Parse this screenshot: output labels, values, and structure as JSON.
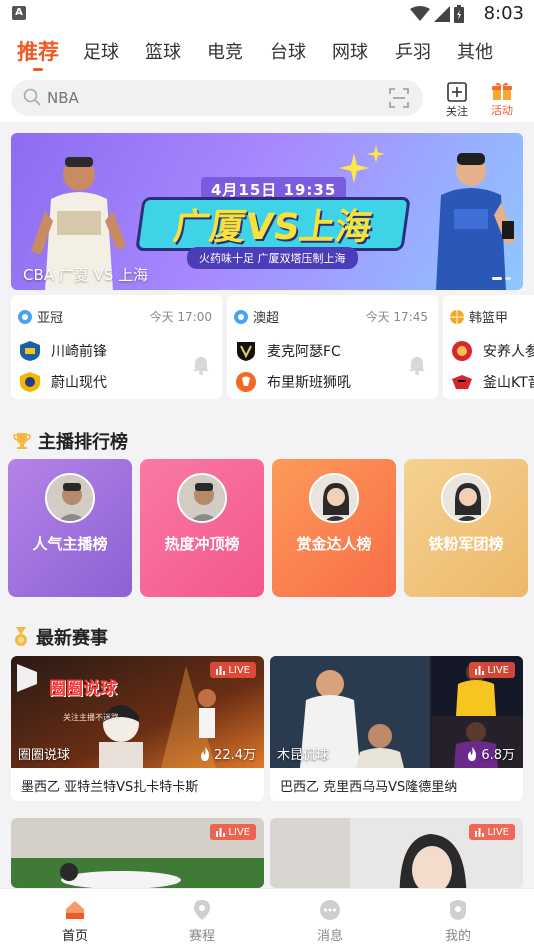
{
  "statusbar": {
    "time": "8:03",
    "app_badge": "A"
  },
  "tabs": [
    {
      "label": "推荐"
    },
    {
      "label": "足球"
    },
    {
      "label": "篮球"
    },
    {
      "label": "电竞"
    },
    {
      "label": "台球"
    },
    {
      "label": "网球"
    },
    {
      "label": "乒羽"
    },
    {
      "label": "其他"
    }
  ],
  "search": {
    "placeholder": "NBA"
  },
  "actions": {
    "follow": "关注",
    "activity": "活动"
  },
  "banner": {
    "date": "4月15日 19:35",
    "headline": "广厦VS上海",
    "sub": "火药味十足 广厦双塔压制上海",
    "caption": "CBA 广夏 VS 上海"
  },
  "matches": [
    {
      "league": "亚冠",
      "time": "今天 17:00",
      "home": "川崎前锋",
      "away": "蔚山现代"
    },
    {
      "league": "澳超",
      "time": "今天 17:45",
      "home": "麦克阿瑟FC",
      "away": "布里斯班狮吼"
    },
    {
      "league": "韩篮甲",
      "time": "",
      "home": "安养人参",
      "away": "釜山KT音"
    }
  ],
  "ranking": {
    "title": "主播排行榜",
    "items": [
      {
        "label": "人气主播榜"
      },
      {
        "label": "热度冲顶榜"
      },
      {
        "label": "赏金达人榜"
      },
      {
        "label": "铁粉军团榜"
      }
    ]
  },
  "latest": {
    "title": "最新赛事",
    "items": [
      {
        "badge": "LIVE",
        "streamer": "圈圈说球",
        "heat": "22.4万",
        "title": "墨西乙 亚特兰特VS扎卡特卡斯",
        "overlay": "圈圈说球",
        "overlay_sub": "关注主播不迷路"
      },
      {
        "badge": "LIVE",
        "streamer": "木昆侃球",
        "heat": "6.8万",
        "title": "巴西乙 克里西乌马VS隆德里纳"
      },
      {
        "badge": "LIVE"
      },
      {
        "badge": "LIVE"
      }
    ]
  },
  "bottom_nav": [
    {
      "label": "首页"
    },
    {
      "label": "赛程"
    },
    {
      "label": "消息"
    },
    {
      "label": "我的"
    }
  ],
  "colors": {
    "accent": "#f05a28",
    "live_badge": "#f0503c"
  }
}
